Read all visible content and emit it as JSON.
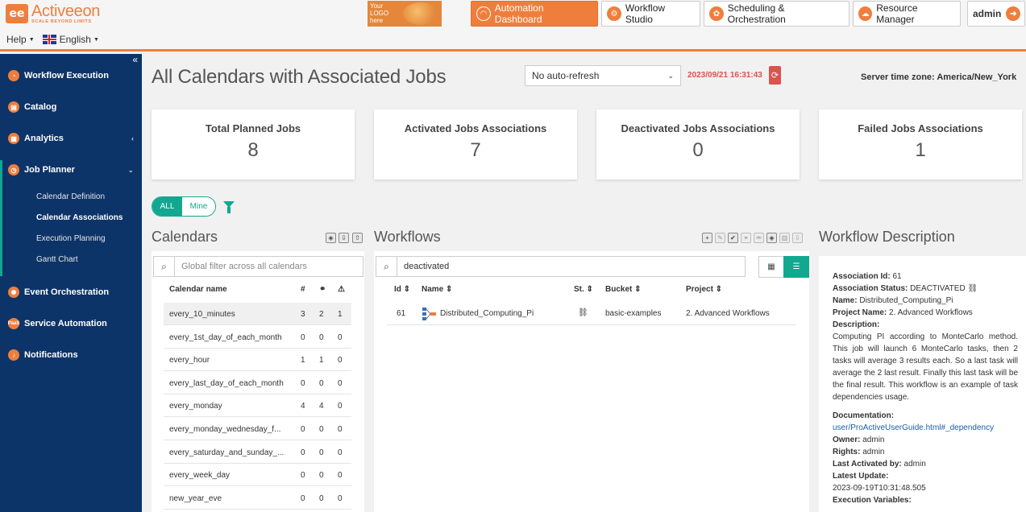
{
  "header": {
    "logo_name": "Activeeon",
    "logo_tagline": "SCALE BEYOND LIMITS",
    "help_label": "Help",
    "language_label": "English",
    "your_logo_text": "Your LOGO here",
    "nav": [
      {
        "label": "Automation Dashboard",
        "icon": "dashboard-icon"
      },
      {
        "label": "Workflow Studio",
        "icon": "workflow-studio-icon"
      },
      {
        "label": "Scheduling & Orchestration",
        "icon": "scheduling-icon"
      },
      {
        "label": "Resource Manager",
        "icon": "cloud-icon"
      }
    ],
    "user_label": "admin",
    "colors": {
      "accent": "#ef7e3c",
      "sidebar": "#0d3468",
      "teal": "#11a88f",
      "danger": "#d9534f"
    }
  },
  "sidebar": {
    "items": [
      {
        "label": "Workflow Execution",
        "icon": "gauge-icon"
      },
      {
        "label": "Catalog",
        "icon": "catalog-icon"
      },
      {
        "label": "Analytics",
        "icon": "analytics-icon"
      },
      {
        "label": "Job Planner",
        "icon": "clock-icon"
      },
      {
        "label": "Event Orchestration",
        "icon": "event-icon"
      },
      {
        "label": "Service Automation",
        "icon": "paas-icon"
      },
      {
        "label": "Notifications",
        "icon": "bell-icon"
      }
    ],
    "job_planner_sub": [
      "Calendar Definition",
      "Calendar Associations",
      "Execution Planning",
      "Gantt Chart"
    ],
    "active_sub": "Calendar Associations"
  },
  "main": {
    "title": "All Calendars with Associated Jobs",
    "refresh_option": "No auto-refresh",
    "timestamp": "2023/09/21 16:31:43",
    "server_timezone": "Server time zone: America/New_York",
    "stats": [
      {
        "label": "Total Planned Jobs",
        "value": "8"
      },
      {
        "label": "Activated Jobs Associations",
        "value": "7"
      },
      {
        "label": "Deactivated Jobs Associations",
        "value": "0"
      },
      {
        "label": "Failed Jobs Associations",
        "value": "1"
      }
    ],
    "toggle": {
      "all": "ALL",
      "mine": "Mine"
    }
  },
  "calendars": {
    "title": "Calendars",
    "search_placeholder": "Global filter across all calendars",
    "columns": {
      "name": "Calendar name",
      "c1": "#",
      "c2": "⚭",
      "c3": "⚠"
    },
    "rows": [
      {
        "name": "every_10_minutes",
        "v1": "3",
        "v2": "2",
        "v3": "1"
      },
      {
        "name": "every_1st_day_of_each_month",
        "v1": "0",
        "v2": "0",
        "v3": "0"
      },
      {
        "name": "every_hour",
        "v1": "1",
        "v2": "1",
        "v3": "0"
      },
      {
        "name": "every_last_day_of_each_month",
        "v1": "0",
        "v2": "0",
        "v3": "0"
      },
      {
        "name": "every_monday",
        "v1": "4",
        "v2": "4",
        "v3": "0"
      },
      {
        "name": "every_monday_wednesday_f...",
        "v1": "0",
        "v2": "0",
        "v3": "0"
      },
      {
        "name": "every_saturday_and_sunday_...",
        "v1": "0",
        "v2": "0",
        "v3": "0"
      },
      {
        "name": "every_week_day",
        "v1": "0",
        "v2": "0",
        "v3": "0"
      },
      {
        "name": "new_year_eve",
        "v1": "0",
        "v2": "0",
        "v3": "0"
      }
    ]
  },
  "workflows": {
    "title": "Workflows",
    "search_value": "deactivated",
    "columns": {
      "id": "Id",
      "name": "Name",
      "status": "St.",
      "bucket": "Bucket",
      "project": "Project"
    },
    "rows": [
      {
        "id": "61",
        "name": "Distributed_Computing_Pi",
        "status": "⛓",
        "bucket": "basic-examples",
        "project": "2. Advanced Workflows"
      }
    ]
  },
  "description": {
    "title": "Workflow Description",
    "association_id_label": "Association Id:",
    "association_id": "61",
    "status_label": "Association Status:",
    "status": "DEACTIVATED",
    "name_label": "Name:",
    "name": "Distributed_Computing_Pi",
    "project_label": "Project Name:",
    "project": "2. Advanced Workflows",
    "description_label": "Description:",
    "description": "Computing PI according to MonteCarlo method. This job will launch 6 MonteCarlo tasks, then 2 tasks will average 3 results each. So a last task will average the 2 last result. Finally this last task will be the final result. This workflow is an example of task dependencies usage.",
    "documentation_label": "Documentation:",
    "documentation": "user/ProActiveUserGuide.html#_dependency",
    "owner_label": "Owner:",
    "owner": "admin",
    "rights_label": "Rights:",
    "rights": "admin",
    "last_activated_label": "Last Activated by:",
    "last_activated": "admin",
    "latest_update_label": "Latest Update:",
    "latest_update": "2023-09-19T10:31:48.505",
    "exec_vars_label": "Execution Variables:"
  }
}
